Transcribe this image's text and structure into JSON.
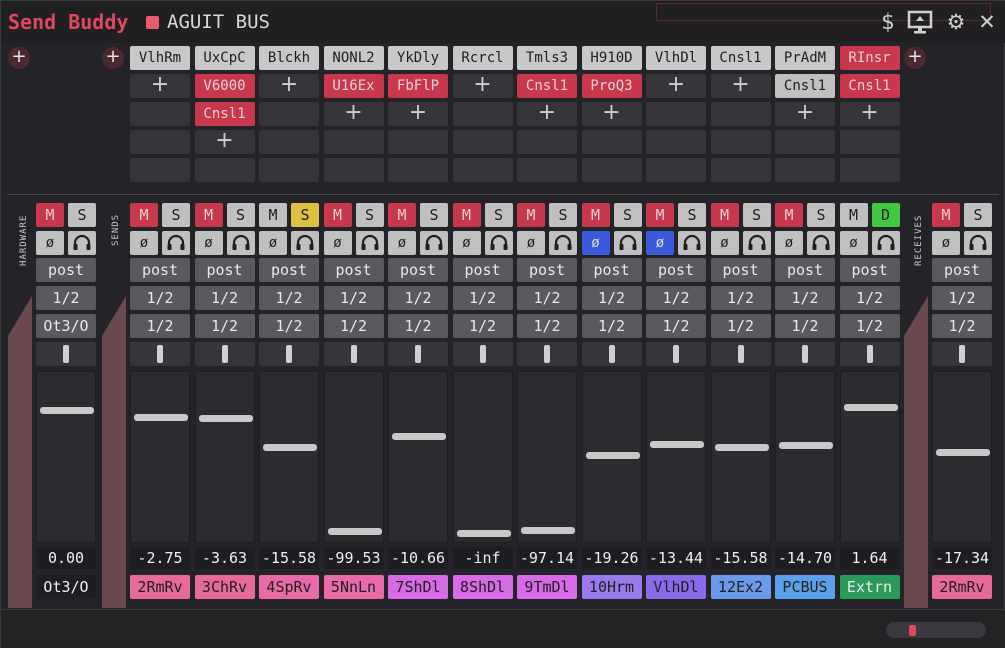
{
  "app": {
    "title": "Send Buddy",
    "bus_name": "AGUIT BUS"
  },
  "header_icons": [
    "dollar-icon",
    "monitor-icon",
    "gear-icon",
    "close-icon"
  ],
  "side_labels": {
    "hardware": "HARDWARE",
    "sends": "SENDS",
    "receives": "RECEIVES"
  },
  "fx_add_symbol": "+",
  "fx_columns": [
    {
      "name": "VlhRm",
      "chain": []
    },
    {
      "name": "UxCpC",
      "chain": [
        "V6000",
        "Cnsl1"
      ]
    },
    {
      "name": "Blckh",
      "chain": []
    },
    {
      "name": "NONL2",
      "chain": [
        "U16Ex"
      ]
    },
    {
      "name": "YkDly",
      "chain": [
        "FbFlP"
      ]
    },
    {
      "name": "Rcrcl",
      "chain": []
    },
    {
      "name": "Tmls3",
      "chain": [
        "Cnsl1"
      ]
    },
    {
      "name": "H910D",
      "chain": [
        "ProQ3"
      ]
    },
    {
      "name": "VlhDl",
      "chain": []
    },
    {
      "name": "Cnsl1",
      "chain": []
    },
    {
      "name": "PrAdM",
      "chain": [
        "Cnsl1"
      ]
    },
    {
      "name": "RInsr",
      "chain": [
        "Cnsl1"
      ]
    }
  ],
  "buttons": {
    "mute": "M",
    "solo": "S",
    "direct": "D",
    "phase": "ø",
    "mode": "post",
    "chan": "1/2"
  },
  "hardware_strip": {
    "mode": "post",
    "ch1": "1/2",
    "ch2": "Ot3/O",
    "volume": "0.00",
    "level": 0.79,
    "dest": "Ot3/O"
  },
  "send_strips": [
    {
      "volume": "-2.75",
      "dest": "2RmRv",
      "color": "#e86a9a",
      "mute_on": true,
      "solo_on": false,
      "phase_on": false,
      "level": 0.75
    },
    {
      "volume": "-3.63",
      "dest": "3ChRv",
      "color": "#e86a9a",
      "mute_on": true,
      "solo_on": false,
      "phase_on": false,
      "level": 0.74
    },
    {
      "volume": "-15.58",
      "dest": "4SpRv",
      "color": "#e86aa8",
      "mute_on": false,
      "solo_on": true,
      "phase_on": false,
      "level": 0.56
    },
    {
      "volume": "-99.53",
      "dest": "5NnLn",
      "color": "#e86aa8",
      "mute_on": true,
      "solo_on": false,
      "phase_on": false,
      "level": 0.03
    },
    {
      "volume": "-10.66",
      "dest": "7ShDl",
      "color": "#d86ae8",
      "mute_on": true,
      "solo_on": false,
      "phase_on": false,
      "level": 0.63
    },
    {
      "volume": "-inf",
      "dest": "8ShDl",
      "color": "#d86ae8",
      "mute_on": true,
      "solo_on": false,
      "phase_on": false,
      "level": 0.02
    },
    {
      "volume": "-97.14",
      "dest": "9TmDl",
      "color": "#d86ae8",
      "mute_on": true,
      "solo_on": false,
      "phase_on": false,
      "level": 0.04
    },
    {
      "volume": "-19.26",
      "dest": "10Hrm",
      "color": "#9a7aea",
      "mute_on": true,
      "solo_on": false,
      "phase_on": true,
      "level": 0.51
    },
    {
      "volume": "-13.44",
      "dest": "VlhDl",
      "color": "#8a6aea",
      "mute_on": true,
      "solo_on": false,
      "phase_on": true,
      "level": 0.58
    },
    {
      "volume": "-15.58",
      "dest": "12Ex2",
      "color": "#6a9aea",
      "mute_on": true,
      "solo_on": false,
      "phase_on": false,
      "level": 0.56
    },
    {
      "volume": "-14.70",
      "dest": "PCBUS",
      "color": "#5aa0ea",
      "mute_on": true,
      "solo_on": false,
      "phase_on": false,
      "level": 0.57
    },
    {
      "volume": "1.64",
      "dest": "Extrn",
      "color": "#2a9a5a",
      "mute_on": false,
      "solo_on": false,
      "direct_on": true,
      "phase_on": false,
      "level": 0.81
    }
  ],
  "receive_strip": {
    "mode": "post",
    "ch1": "1/2",
    "ch2": "1/2",
    "volume": "-17.34",
    "dest": "2RmRv",
    "color": "#e86a9a",
    "level": 0.53
  }
}
